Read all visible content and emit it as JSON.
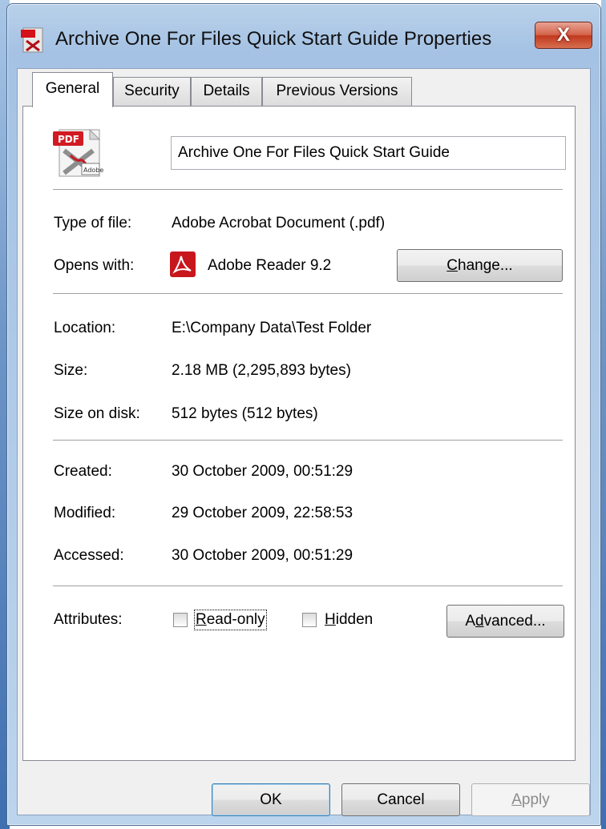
{
  "window": {
    "title": "Archive One For Files Quick Start Guide Properties",
    "close_glyph": "X"
  },
  "tabs": [
    {
      "label": "General",
      "active": true
    },
    {
      "label": "Security",
      "active": false
    },
    {
      "label": "Details",
      "active": false
    },
    {
      "label": "Previous Versions",
      "active": false
    }
  ],
  "file": {
    "name": "Archive One For Files Quick Start Guide",
    "icon": "pdf-file-icon",
    "icon_badge": "PDF",
    "icon_brand": "Adobe"
  },
  "type_of_file": {
    "label": "Type of file:",
    "value": "Adobe Acrobat Document (.pdf)"
  },
  "opens_with": {
    "label": "Opens with:",
    "app": "Adobe Reader 9.2",
    "app_icon": "adobe-reader-icon",
    "change_prefix": "",
    "change_mnemonic": "C",
    "change_rest": "hange..."
  },
  "location": {
    "label": "Location:",
    "value": "E:\\Company Data\\Test Folder"
  },
  "size": {
    "label": "Size:",
    "value": "2.18 MB (2,295,893 bytes)"
  },
  "size_on_disk": {
    "label": "Size on disk:",
    "value": "512 bytes (512 bytes)"
  },
  "created": {
    "label": "Created:",
    "value": "30 October 2009, 00:51:29"
  },
  "modified": {
    "label": "Modified:",
    "value": "29 October 2009, 22:58:53"
  },
  "accessed": {
    "label": "Accessed:",
    "value": "30 October 2009, 00:51:29"
  },
  "attributes": {
    "label": "Attributes:",
    "readonly": {
      "mnemonic": "R",
      "rest": "ead-only",
      "checked": false
    },
    "hidden": {
      "mnemonic": "H",
      "rest": "idden",
      "checked": false
    },
    "advanced": {
      "prefix": "A",
      "mnemonic": "d",
      "rest": "vanced..."
    }
  },
  "buttons": {
    "ok": "OK",
    "cancel": "Cancel",
    "apply_mnemonic": "A",
    "apply_rest": "pply"
  },
  "colors": {
    "adobe_red": "#c8161d",
    "close_red": "#c0391f"
  }
}
